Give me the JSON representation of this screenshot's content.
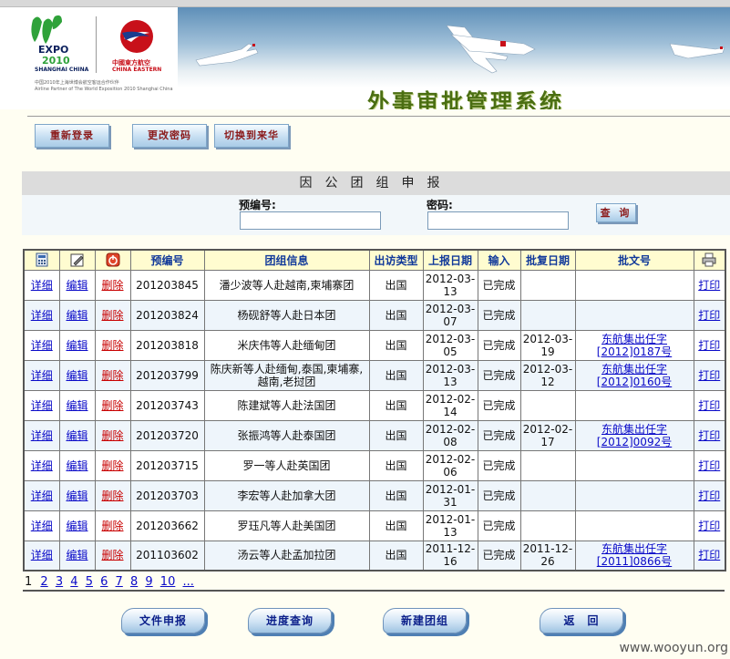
{
  "header": {
    "expo_text": "EXPO",
    "expo_year": "2010",
    "expo_city": "SHANGHAI CHINA",
    "airline_cn": "中國東方航空",
    "airline_en": "CHINA EASTERN",
    "partner_cn": "中国2010年上海世博会航空客运合作伙伴",
    "partner_en": "Airline Partner of The World Exposition 2010 Shanghai China",
    "system_title": "外事审批管理系统"
  },
  "nav": {
    "relogin": "重新登录",
    "change_password": "更改密码",
    "switch": "切换到来华"
  },
  "section": {
    "title": "因公团组申报",
    "preno_label": "预编号:",
    "password_label": "密码:",
    "preno_value": "",
    "password_value": "",
    "query": "查 询"
  },
  "table": {
    "headers": [
      "",
      "",
      "",
      "预编号",
      "团组信息",
      "出访类型",
      "上报日期",
      "输入",
      "批复日期",
      "批文号",
      ""
    ],
    "action_labels": {
      "detail": "详细",
      "edit": "编辑",
      "delete": "删除",
      "print": "打印"
    },
    "rows": [
      {
        "preno": "201203845",
        "info": "潘少波等人赴越南,柬埔寨团",
        "type": "出国",
        "report_date": "2012-03-13",
        "input": "已完成",
        "approve_date": "",
        "doc_no": ""
      },
      {
        "preno": "201203824",
        "info": "杨砚舒等人赴日本团",
        "type": "出国",
        "report_date": "2012-03-07",
        "input": "已完成",
        "approve_date": "",
        "doc_no": ""
      },
      {
        "preno": "201203818",
        "info": "米庆伟等人赴缅甸团",
        "type": "出国",
        "report_date": "2012-03-05",
        "input": "已完成",
        "approve_date": "2012-03-19",
        "doc_no": "东航集出任字[2012]0187号"
      },
      {
        "preno": "201203799",
        "info": "陈庆新等人赴缅甸,泰国,柬埔寨,越南,老挝团",
        "type": "出国",
        "report_date": "2012-03-13",
        "input": "已完成",
        "approve_date": "2012-03-12",
        "doc_no": "东航集出任字[2012]0160号"
      },
      {
        "preno": "201203743",
        "info": "陈建斌等人赴法国团",
        "type": "出国",
        "report_date": "2012-02-14",
        "input": "已完成",
        "approve_date": "",
        "doc_no": ""
      },
      {
        "preno": "201203720",
        "info": "张振鸿等人赴泰国团",
        "type": "出国",
        "report_date": "2012-02-08",
        "input": "已完成",
        "approve_date": "2012-02-17",
        "doc_no": "东航集出任字[2012]0092号"
      },
      {
        "preno": "201203715",
        "info": "罗一等人赴英国团",
        "type": "出国",
        "report_date": "2012-02-06",
        "input": "已完成",
        "approve_date": "",
        "doc_no": ""
      },
      {
        "preno": "201203703",
        "info": "李宏等人赴加拿大团",
        "type": "出国",
        "report_date": "2012-01-31",
        "input": "已完成",
        "approve_date": "",
        "doc_no": ""
      },
      {
        "preno": "201203662",
        "info": "罗珏凡等人赴美国团",
        "type": "出国",
        "report_date": "2012-01-13",
        "input": "已完成",
        "approve_date": "",
        "doc_no": ""
      },
      {
        "preno": "201103602",
        "info": "汤云等人赴孟加拉团",
        "type": "出国",
        "report_date": "2011-12-16",
        "input": "已完成",
        "approve_date": "2011-12-26",
        "doc_no": "东航集出任字[2011]0866号"
      }
    ]
  },
  "pager": {
    "current": "1",
    "pages": [
      "2",
      "3",
      "4",
      "5",
      "6",
      "7",
      "8",
      "9",
      "10",
      "..."
    ]
  },
  "bottom": {
    "file_apply": "文件申报",
    "progress_query": "进度查询",
    "new_group": "新建团组",
    "back": "返　回"
  },
  "watermark": "www.wooyun.org",
  "colors": {
    "link": "#0a0ac8",
    "delete": "#c80000",
    "header_text": "#123a9a",
    "title_green": "#4a6e12"
  }
}
